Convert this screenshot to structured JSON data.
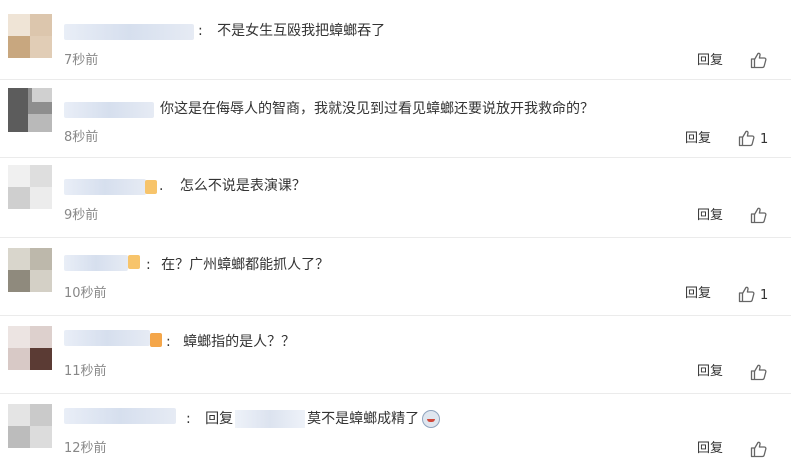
{
  "comments": [
    {
      "text_prefix": ":",
      "text": "不是女生互殴我把蟑螂吞了",
      "time": "7秒前",
      "reply": "回复",
      "likes": ""
    },
    {
      "text_prefix": "",
      "text": "你这是在侮辱人的智商，我就没见到过看见蟑螂还要说放开我救命的？",
      "time": "8秒前",
      "reply": "回复",
      "likes": "1"
    },
    {
      "text_prefix": ".",
      "text": "怎么不说是表演课？",
      "time": "9秒前",
      "reply": "回复",
      "likes": ""
    },
    {
      "text_prefix": ":",
      "text": "在？广州蟑螂都能抓人了？",
      "time": "10秒前",
      "reply": "回复",
      "likes": "1"
    },
    {
      "text_prefix": ":",
      "text": "蟑螂指的是人？？",
      "time": "11秒前",
      "reply": "回复",
      "likes": ""
    },
    {
      "text_prefix": ":",
      "text_reply_word": "回复",
      "text": "莫不是蟑螂成精了",
      "time": "12秒前",
      "reply": "回复",
      "likes": ""
    }
  ],
  "icons": {
    "like": "thumbs-up-icon",
    "emoji": "face-emoji-icon"
  },
  "colors": {
    "text": "#333333",
    "time": "#888888",
    "divider": "#ebebeb",
    "name_blur": "#d6dfee"
  }
}
